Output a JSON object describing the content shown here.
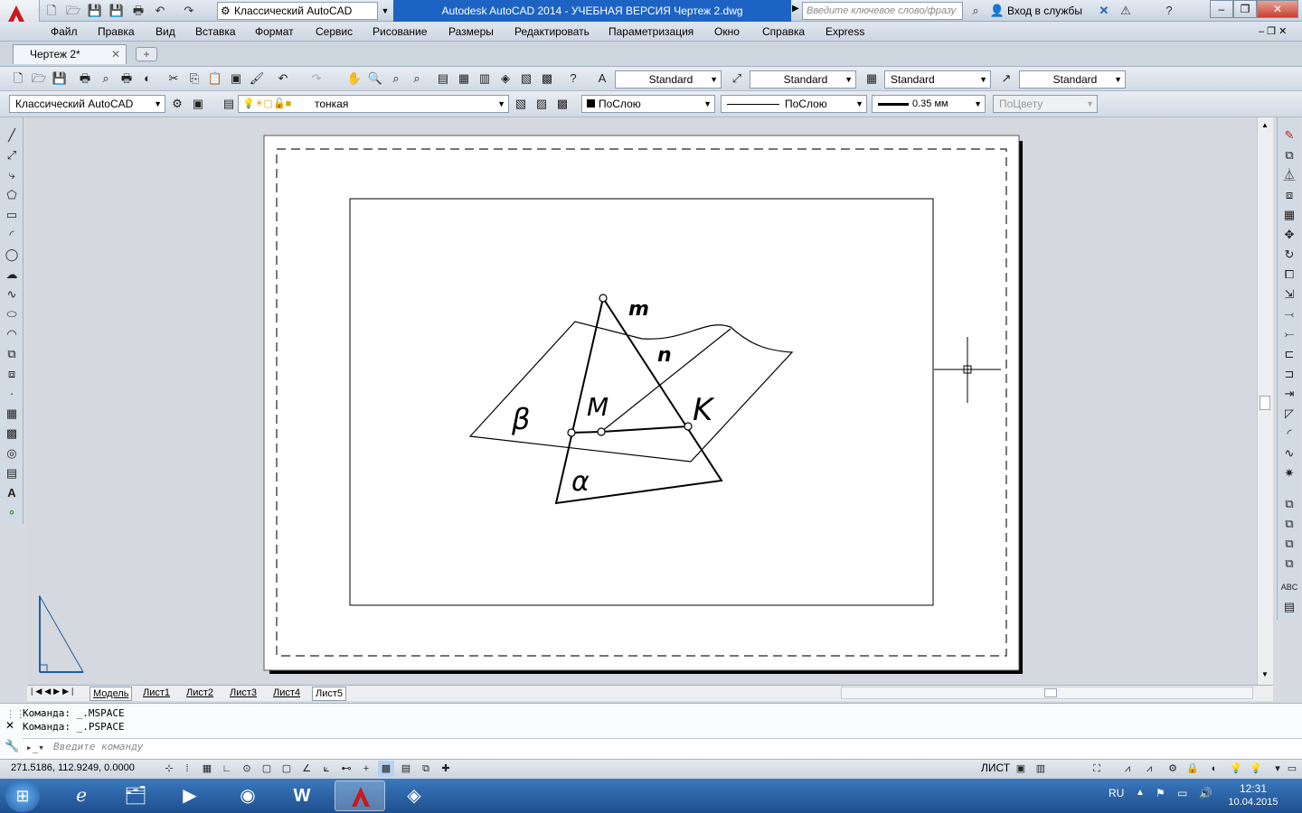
{
  "title_bar": {
    "workspace": "Классический AutoCAD",
    "window_title": "Autodesk AutoCAD 2014 - УЧЕБНАЯ ВЕРСИЯ    Чертеж 2.dwg",
    "search_placeholder": "Введите ключевое слово/фразу",
    "signin": "Вход в службы"
  },
  "menu": [
    "Файл",
    "Правка",
    "Вид",
    "Вставка",
    "Формат",
    "Сервис",
    "Рисование",
    "Размеры",
    "Редактировать",
    "Параметризация",
    "Окно",
    "Справка",
    "Express"
  ],
  "doc_tab": "Чертеж 2*",
  "styles": {
    "text_style": "Standard",
    "dim_style": "Standard",
    "table_style": "Standard",
    "mleader_style": "Standard"
  },
  "layers": {
    "workspace": "Классический AutoCAD",
    "current_layer": "тонкая",
    "color": "ПоСлою",
    "linetype": "ПоСлою",
    "lineweight": "0.35 мм",
    "plotstyle": "ПоЦвету"
  },
  "drawing": {
    "labels": {
      "m": "m",
      "n": "n",
      "M": "M",
      "K": "K",
      "beta": "β",
      "alpha": "α"
    }
  },
  "layout_tabs": [
    "Модель",
    "Лист1",
    "Лист2",
    "Лист3",
    "Лист4",
    "Лист5"
  ],
  "command": {
    "history": [
      "Команда:  _.MSPACE",
      "Команда:  _.PSPACE"
    ],
    "placeholder": "Введите команду"
  },
  "status": {
    "coords": "271.5186, 112.9249, 0.0000",
    "space": "ЛИСТ"
  },
  "taskbar": {
    "lang": "RU",
    "time": "12:31",
    "date": "10.04.2015"
  },
  "colors": {
    "title_active": "#1c63c4",
    "taskbar": "#2a62a8",
    "autocad_red": "#c8191b"
  }
}
